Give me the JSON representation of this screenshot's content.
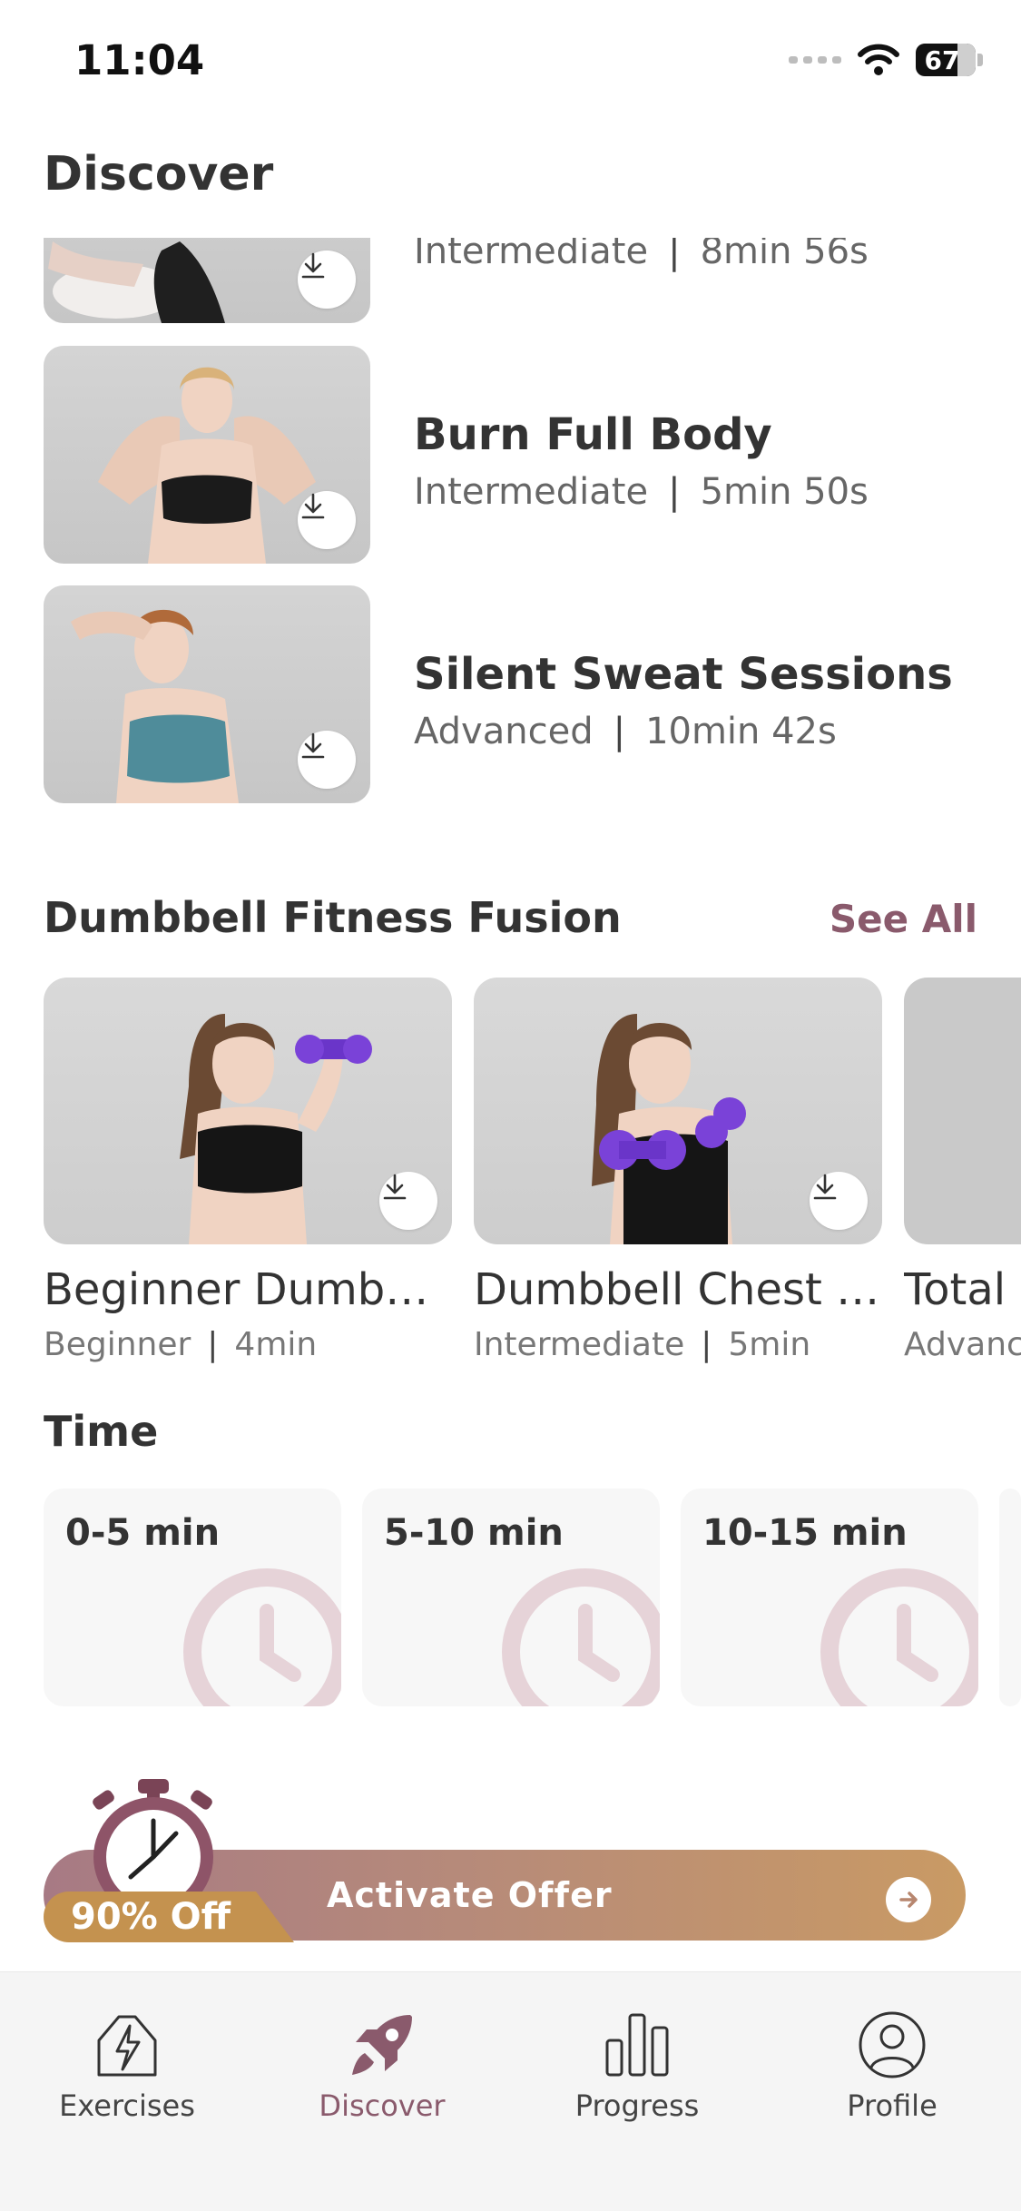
{
  "status": {
    "time": "11:04",
    "battery": "67"
  },
  "header": {
    "title": "Discover"
  },
  "workouts": [
    {
      "title": "",
      "level": "Intermediate",
      "duration": "8min 56s"
    },
    {
      "title": "Burn Full Body",
      "level": "Intermediate",
      "duration": "5min 50s"
    },
    {
      "title": "Silent Sweat Sessions",
      "level": "Advanced",
      "duration": "10min 42s"
    }
  ],
  "dumbbell": {
    "title": "Dumbbell Fitness Fusion",
    "see_all": "See All",
    "cards": [
      {
        "title": "Beginner Dumbbe...",
        "level": "Beginner",
        "duration": "4min"
      },
      {
        "title": "Dumbbell Chest S...",
        "level": "Intermediate",
        "duration": "5min"
      },
      {
        "title": "Total",
        "level": "Advanc",
        "duration": ""
      }
    ]
  },
  "time_section": {
    "title": "Time",
    "ranges": [
      "0-5 min",
      "5-10 min",
      "10-15 min"
    ]
  },
  "offer": {
    "badge": "90% Off",
    "label": "Activate Offer"
  },
  "tabs": [
    {
      "label": "Exercises",
      "active": false
    },
    {
      "label": "Discover",
      "active": true
    },
    {
      "label": "Progress",
      "active": false
    },
    {
      "label": "Profile",
      "active": false
    }
  ],
  "colors": {
    "accent": "#8a5a6c",
    "offer_start": "#a77a84",
    "offer_end": "#c99a64",
    "badge": "#c4924f"
  },
  "separator": "|"
}
